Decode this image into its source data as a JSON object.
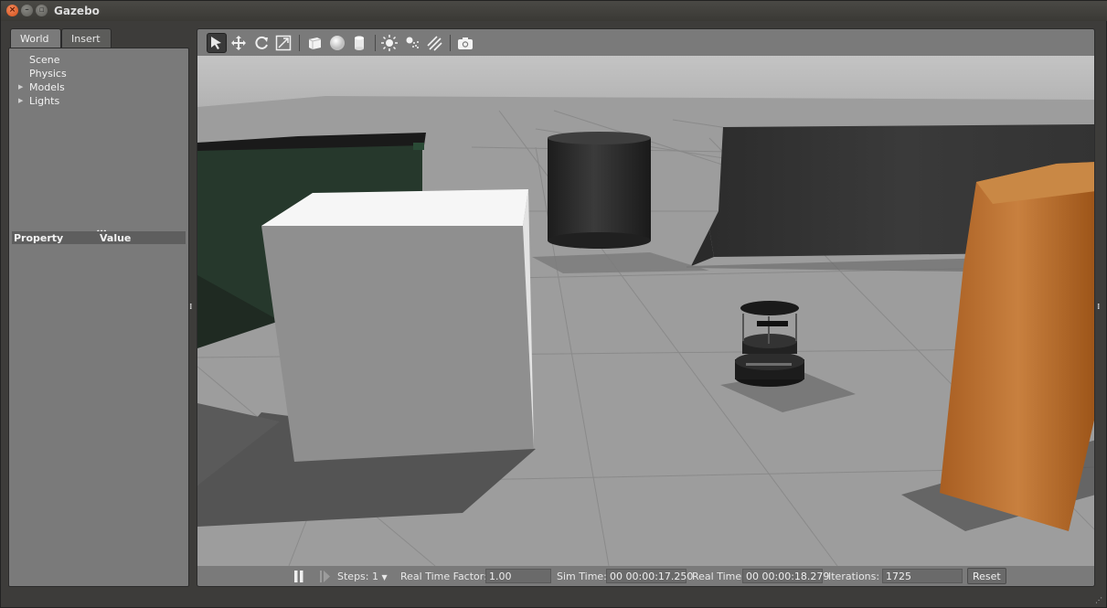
{
  "window": {
    "title": "Gazebo"
  },
  "left_panel": {
    "tabs": [
      {
        "label": "World"
      },
      {
        "label": "Insert"
      }
    ],
    "tree": [
      {
        "label": "Scene",
        "expandable": false
      },
      {
        "label": "Physics",
        "expandable": false
      },
      {
        "label": "Models",
        "expandable": true
      },
      {
        "label": "Lights",
        "expandable": true
      }
    ],
    "property_table": {
      "col_property": "Property",
      "col_value": "Value"
    }
  },
  "toolbar": {
    "tools": [
      {
        "icon": "select-arrow-icon",
        "active": true
      },
      {
        "icon": "translate-icon"
      },
      {
        "icon": "rotate-icon"
      },
      {
        "icon": "scale-icon"
      },
      {
        "icon": "box-shape-icon"
      },
      {
        "icon": "sphere-shape-icon"
      },
      {
        "icon": "cylinder-shape-icon"
      },
      {
        "icon": "point-light-icon"
      },
      {
        "icon": "spot-light-icon"
      },
      {
        "icon": "directional-light-icon"
      },
      {
        "icon": "screenshot-camera-icon"
      }
    ]
  },
  "statusbar": {
    "steps_label": "Steps:",
    "steps_value": "1",
    "rtf_label": "Real Time Factor:",
    "rtf_value": "1.00",
    "sim_time_label": "Sim Time:",
    "sim_time_value": "00 00:00:17.250",
    "real_time_label": "Real Time:",
    "real_time_value": "00 00:00:18.279",
    "iterations_label": "Iterations:",
    "iterations_value": "1725",
    "reset_label": "Reset"
  },
  "colors": {
    "panel_bg": "#7a7a7a",
    "window_bg": "#3d3c3a",
    "ground": "#9b9b9b",
    "sky": "#bdbdbd",
    "box_white": "#f4f4f4",
    "wood": "#b5682a"
  }
}
